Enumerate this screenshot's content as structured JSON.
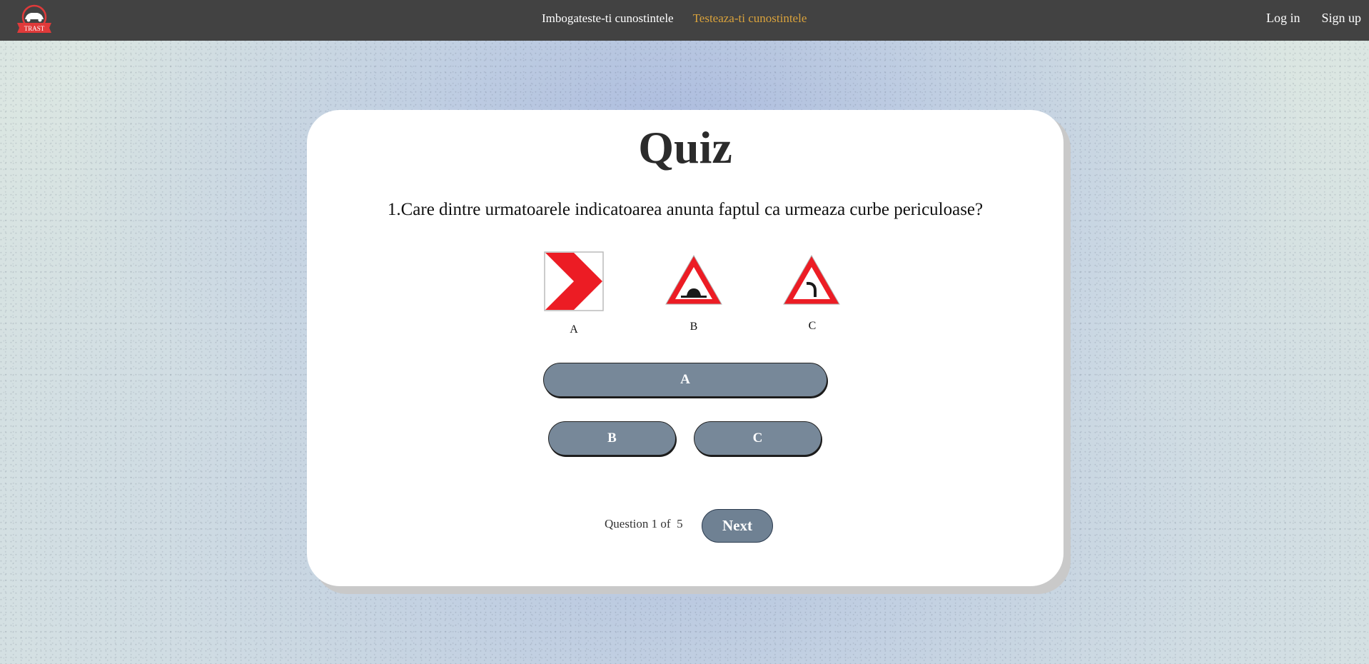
{
  "navbar": {
    "logo_text": "TRAST",
    "links": [
      "Imbogateste-ti cunostintele",
      "Testeaza-ti cunostintele"
    ],
    "auth": [
      "Log in",
      "Sign up"
    ],
    "active_color": "#d9a23c",
    "background_color": "#424242"
  },
  "quiz": {
    "title": "Quiz",
    "question": "1.Care dintre urmatoarele indicatoarea anunta faptul ca urmeaza curbe periculoase?",
    "signs": [
      {
        "label": "A",
        "icon": "chevron-turn-sign-icon"
      },
      {
        "label": "B",
        "icon": "speed-bump-warning-sign-icon"
      },
      {
        "label": "C",
        "icon": "dangerous-curve-warning-sign-icon"
      }
    ],
    "answers": [
      "A",
      "B",
      "C"
    ],
    "progress": {
      "prefix": "Question",
      "current": "1",
      "of": "of",
      "total": "5"
    },
    "next_label": "Next",
    "button_color": "#778899"
  }
}
